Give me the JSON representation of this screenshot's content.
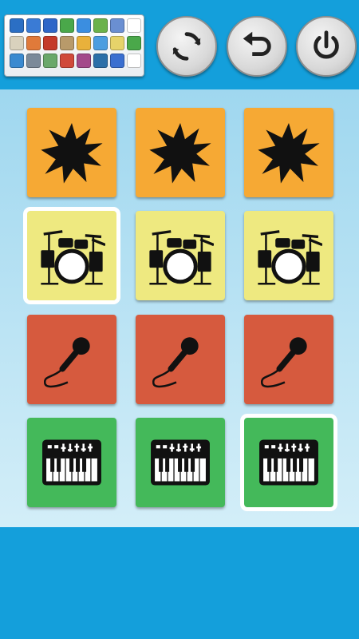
{
  "apps_panel": {
    "icons": [
      {
        "name": "browser-app-icon",
        "color": "#2b6fc4"
      },
      {
        "name": "checklist-app-icon",
        "color": "#3a7bd5"
      },
      {
        "name": "tasks-app-icon",
        "color": "#2e66c8"
      },
      {
        "name": "eye-app-icon",
        "color": "#4aa84a"
      },
      {
        "name": "dropbox-app-icon",
        "color": "#3b8ee0"
      },
      {
        "name": "evernote-app-icon",
        "color": "#6bb24a"
      },
      {
        "name": "tool-app-icon",
        "color": "#6a8fd2"
      },
      {
        "name": "placeholder-app-icon",
        "color": "#ffffff"
      },
      {
        "name": "weather-app-icon",
        "color": "#d9d2bd"
      },
      {
        "name": "paint-app-icon",
        "color": "#e07a3a"
      },
      {
        "name": "social-app-icon",
        "color": "#c43a2b"
      },
      {
        "name": "calendar-app-icon",
        "color": "#b89a6a"
      },
      {
        "name": "photos-app-icon",
        "color": "#e9b13b"
      },
      {
        "name": "game-app-icon",
        "color": "#4b9de0"
      },
      {
        "name": "notes-app-icon",
        "color": "#e6d36a"
      },
      {
        "name": "windows-app-icon",
        "color": "#4aa84a"
      },
      {
        "name": "world-app-icon",
        "color": "#3a8ad0"
      },
      {
        "name": "settings-app-icon",
        "color": "#7b8a99"
      },
      {
        "name": "map-app-icon",
        "color": "#6aa86a"
      },
      {
        "name": "mail-app-icon",
        "color": "#d04a3a"
      },
      {
        "name": "media-app-icon",
        "color": "#a34a8a"
      },
      {
        "name": "wordpress-app-icon",
        "color": "#2b6fa8"
      },
      {
        "name": "store-app-icon",
        "color": "#3a6fd0"
      },
      {
        "name": "blank-app-icon",
        "color": "#ffffff"
      }
    ]
  },
  "toolbar": {
    "refresh_icon": "refresh-icon",
    "undo_icon": "undo-icon",
    "power_icon": "power-icon"
  },
  "board": {
    "rows": [
      {
        "kind": "explosion",
        "icon": "explosion-icon",
        "color": "#f6a934",
        "tiles": [
          {
            "selected": false
          },
          {
            "selected": false
          },
          {
            "selected": false
          }
        ]
      },
      {
        "kind": "drums",
        "icon": "drum-kit-icon",
        "color": "#eee980",
        "tiles": [
          {
            "selected": true
          },
          {
            "selected": false
          },
          {
            "selected": false
          }
        ]
      },
      {
        "kind": "mic",
        "icon": "microphone-icon",
        "color": "#d65a3e",
        "tiles": [
          {
            "selected": false
          },
          {
            "selected": false
          },
          {
            "selected": false
          }
        ]
      },
      {
        "kind": "keys",
        "icon": "keyboard-synth-icon",
        "color": "#44b95a",
        "tiles": [
          {
            "selected": false
          },
          {
            "selected": false
          },
          {
            "selected": true
          }
        ]
      }
    ]
  }
}
